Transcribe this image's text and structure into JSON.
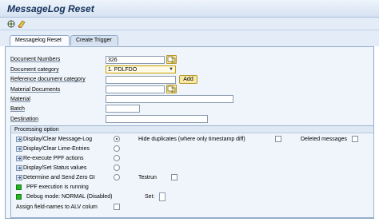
{
  "window": {
    "title": "MessageLog Reset"
  },
  "tabs": [
    {
      "label": "Messagelog Reset"
    },
    {
      "label": "Create Trigger"
    }
  ],
  "form": {
    "document_numbers": {
      "label": "Document Numbers",
      "value": "326"
    },
    "document_category": {
      "label": "Document category",
      "value": "1. PDLFDO"
    },
    "reference_document_category": {
      "label": "Reference document category",
      "value": "",
      "add_label": "Add"
    },
    "material_documents": {
      "label": "Material Documents",
      "value": ""
    },
    "material": {
      "label": "Material",
      "value": ""
    },
    "batch": {
      "label": "Batch",
      "value": ""
    },
    "destination": {
      "label": "Destination",
      "value": ""
    }
  },
  "processing": {
    "title": "Processing option",
    "options": [
      {
        "label": "Display/Clear Message-Log",
        "selected": true
      },
      {
        "label": "Display/Clear Lime-Entries",
        "selected": false
      },
      {
        "label": "Re-execute PPF actions",
        "selected": false
      },
      {
        "label": "Display/Set Status values",
        "selected": false
      },
      {
        "label": "Determine and Send Zero GI",
        "selected": false
      }
    ],
    "hide_duplicates": "Hide duplicates (where only timestamp diff)",
    "deleted_messages": "Deleted messages",
    "testrun": "Testrun",
    "ppf_status": "PPF execution is running",
    "debug_mode": "Debug mode: NORMAL (Disabled)",
    "set_label": "Set:",
    "assign_alv": "Assign field-names to ALV colum"
  },
  "colors": {
    "accent": "#15315a",
    "status_green": "#22b522",
    "f4_button": "#f7e9a5"
  },
  "icons": [
    "execute-icon",
    "eraser-icon",
    "value-help-icon",
    "dropdown-arrow-icon",
    "action-icon"
  ]
}
